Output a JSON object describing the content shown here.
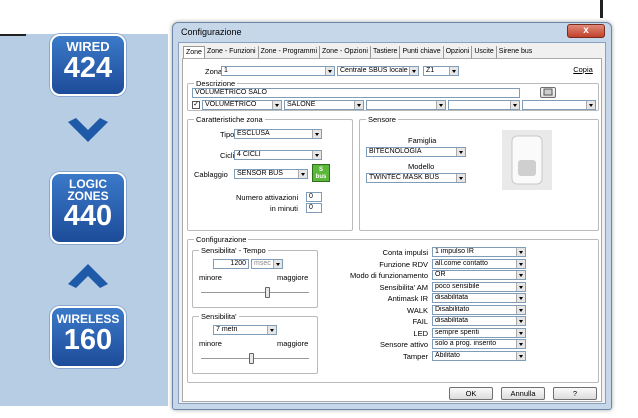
{
  "badges": {
    "wired": {
      "label": "WIRED",
      "number": "424"
    },
    "logic": {
      "line1": "LOGIC",
      "line2": "ZONES",
      "number": "440"
    },
    "wireless": {
      "label": "WIRELESS",
      "number": "160"
    }
  },
  "window": {
    "title": "Configurazione",
    "close": "x"
  },
  "tabs": [
    "Zone",
    "Zone - Funzioni",
    "Zone - Programmi",
    "Zone - Opzioni",
    "Tastiere",
    "Punti chiave",
    "Opzioni",
    "Uscite",
    "Sirene bus"
  ],
  "top": {
    "zona_label": "Zona",
    "zona_value": "1",
    "centrale_value": "Centrale SBUS locale",
    "z_value": "Z1",
    "copia_label": "Copia"
  },
  "descrizione": {
    "title": "Descrizione",
    "text": "VOLUMETRICO SALO",
    "combo1": "VOLUMETRICO",
    "combo2": "SALONE",
    "combo3": "",
    "combo4": "",
    "combo5": ""
  },
  "caratteristiche": {
    "title": "Caratteristiche zona",
    "tipo_label": "Tipo",
    "tipo_value": "ESCLUSA",
    "cicli_label": "Cicli",
    "cicli_value": "4 CICLI",
    "cablaggio_label": "Cablaggio",
    "cablaggio_value": "SENSOR BUS",
    "bus_badge_top": "S",
    "bus_badge_bottom": "bus",
    "num_label1": "Numero attivazioni",
    "num_value": "0",
    "num_label2": "in minuti",
    "min_value": "0"
  },
  "sensore": {
    "title": "Sensore",
    "famiglia_label": "Famiglia",
    "famiglia_value": "BITECNOLOGIA",
    "modello_label": "Modello",
    "modello_value": "TWINTEC MASK BUS"
  },
  "configurazione": {
    "title": "Configurazione",
    "tempo": {
      "title": "Sensibilita' - Tempo",
      "value": "1200",
      "unit": "msec",
      "minore": "minore",
      "maggiore": "maggiore"
    },
    "sens": {
      "title": "Sensibilita'",
      "value": "7 metri",
      "minore": "minore",
      "maggiore": "maggiore"
    },
    "options": [
      {
        "label": "Conta impulsi",
        "value": "1 impulso IR"
      },
      {
        "label": "Funzione RDV",
        "value": "all.come contatto"
      },
      {
        "label": "Modo di funzionamento",
        "value": "OR"
      },
      {
        "label": "Sensibilita' AM",
        "value": "poco sensibile"
      },
      {
        "label": "Antimask IR",
        "value": "disabilitata"
      },
      {
        "label": "WALK",
        "value": "Disabilitato"
      },
      {
        "label": "FAIL",
        "value": "disabilitata"
      },
      {
        "label": "LED",
        "value": "sempre spenti"
      },
      {
        "label": "Sensore attivo",
        "value": "solo a prog. inserito"
      },
      {
        "label": "Tamper",
        "value": "Abilitato"
      }
    ]
  },
  "buttons": {
    "ok": "OK",
    "annulla": "Annulla",
    "help": "?"
  }
}
